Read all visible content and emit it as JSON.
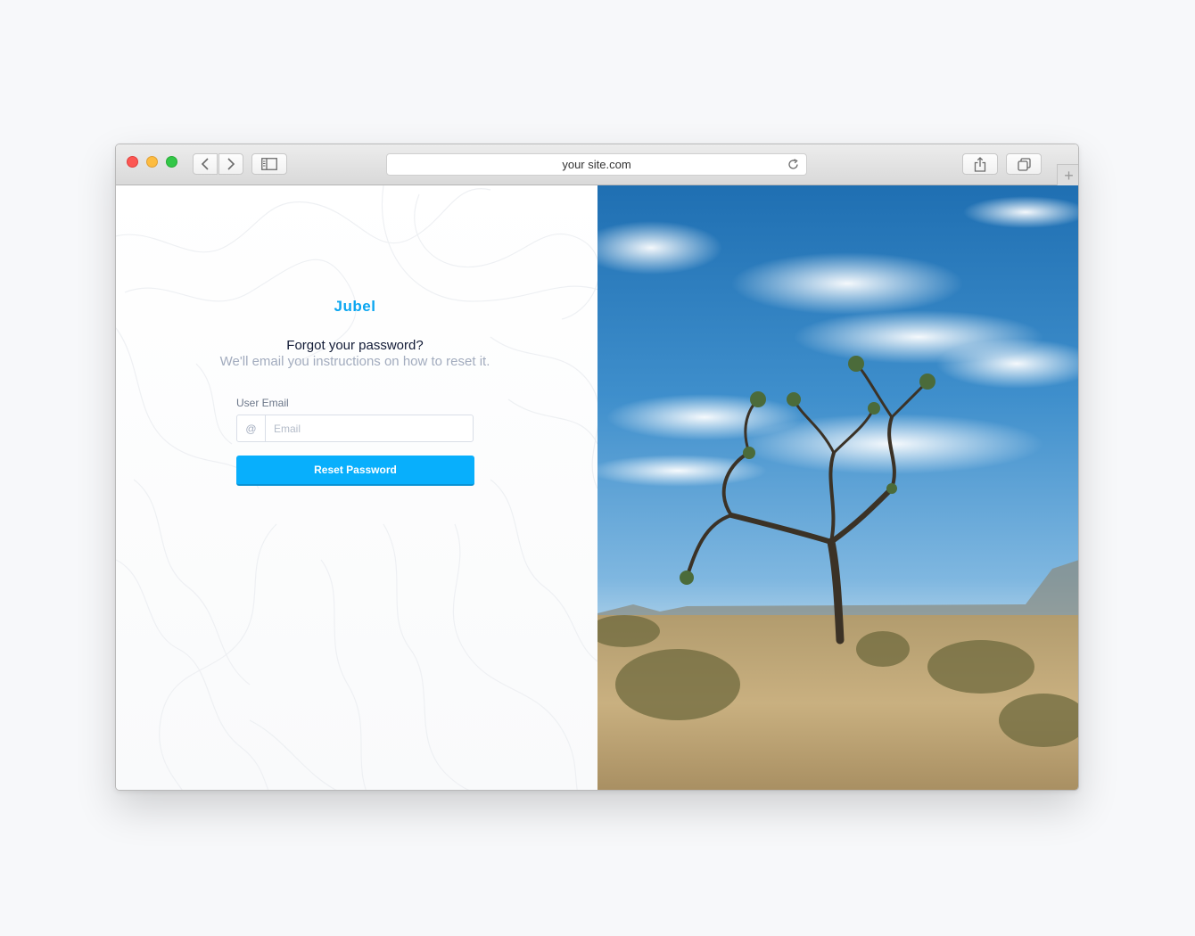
{
  "browser": {
    "address": "your site.com",
    "new_tab_symbol": "+"
  },
  "page": {
    "brand": "Jubel",
    "title": "Forgot your password?",
    "subtitle": "We'll email you instructions on how to reset it.",
    "email_label": "User Email",
    "email_addon": "@",
    "email_placeholder": "Email",
    "email_value": "",
    "submit_label": "Reset Password"
  },
  "colors": {
    "accent": "#08affc",
    "brand": "#0aa6f0",
    "title": "#111a35",
    "muted": "#a2acbe"
  },
  "icons": [
    "back-icon",
    "forward-icon",
    "sidebar-icon",
    "reload-icon",
    "share-icon",
    "tabs-icon",
    "at-icon"
  ],
  "hero_image": "joshua-tree-desert-photo"
}
